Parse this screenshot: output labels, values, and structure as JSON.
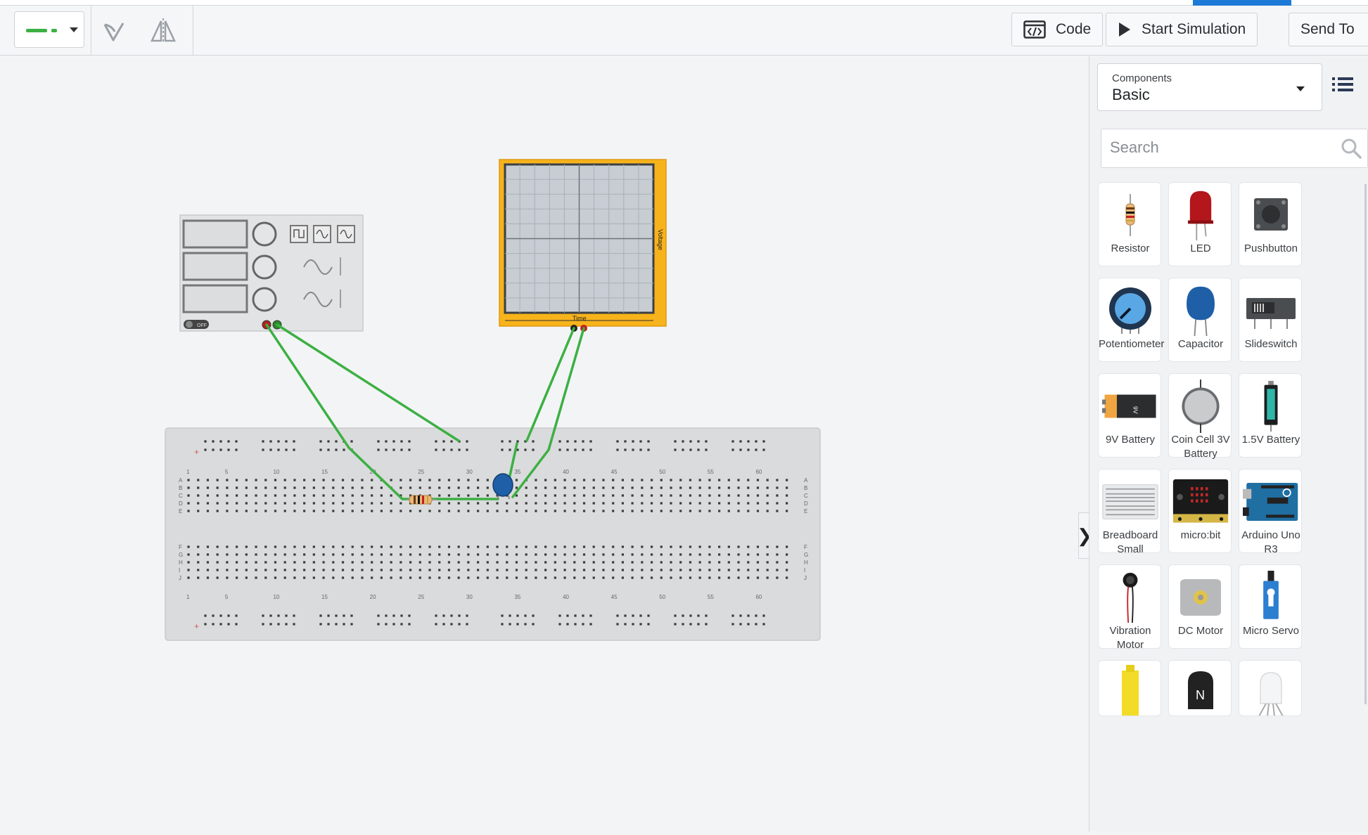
{
  "toolbar": {
    "wire_picker_icon": "wire-color-icon",
    "rotate_icon": "rotate-icon",
    "flip_icon": "flip-icon",
    "code_label": "Code",
    "start_sim_label": "Start Simulation",
    "send_to_label": "Send To"
  },
  "panel": {
    "components_label": "Components",
    "components_value": "Basic",
    "search_placeholder": "Search",
    "items": [
      {
        "label": "Resistor",
        "icon": "resistor-icon"
      },
      {
        "label": "LED",
        "icon": "led-icon"
      },
      {
        "label": "Pushbutton",
        "icon": "pushbutton-icon"
      },
      {
        "label": "Potentiometer",
        "icon": "potentiometer-icon"
      },
      {
        "label": "Capacitor",
        "icon": "capacitor-icon"
      },
      {
        "label": "Slideswitch",
        "icon": "slideswitch-icon"
      },
      {
        "label": "9V Battery",
        "icon": "battery-9v-icon"
      },
      {
        "label": "Coin Cell 3V Battery",
        "icon": "coin-cell-icon"
      },
      {
        "label": "1.5V Battery",
        "icon": "battery-aa-icon"
      },
      {
        "label": "Breadboard Small",
        "icon": "breadboard-icon"
      },
      {
        "label": "micro:bit",
        "icon": "microbit-icon"
      },
      {
        "label": "Arduino Uno R3",
        "icon": "arduino-icon"
      },
      {
        "label": "Vibration Motor",
        "icon": "vibration-motor-icon"
      },
      {
        "label": "DC Motor",
        "icon": "dc-motor-icon"
      },
      {
        "label": "Micro Servo",
        "icon": "micro-servo-icon"
      }
    ],
    "partial_items": [
      "hobby-gearmotor-icon",
      "npn-transistor-icon",
      "rgb-led-icon"
    ]
  },
  "canvas": {
    "function_generator": {
      "switch_label": "OFF"
    },
    "oscilloscope": {
      "y_label": "Voltage",
      "x_label": "Time"
    },
    "breadboard": {
      "column_numbers": [
        "1",
        "5",
        "10",
        "15",
        "20",
        "25",
        "30",
        "35",
        "40",
        "45",
        "50",
        "55",
        "60"
      ],
      "row_letters_top": [
        "A",
        "B",
        "C",
        "D",
        "E"
      ],
      "row_letters_bottom": [
        "F",
        "G",
        "H",
        "I",
        "J"
      ]
    },
    "wire_color": "#3cb043"
  }
}
